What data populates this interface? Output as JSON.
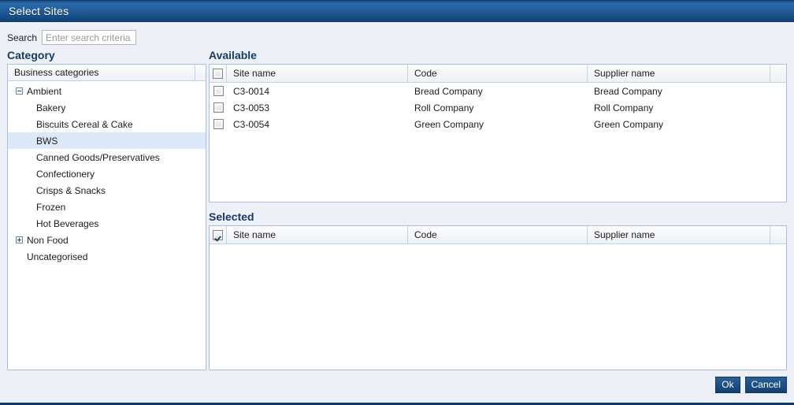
{
  "window": {
    "title": "Select Sites"
  },
  "search": {
    "label": "Search",
    "placeholder": "Enter search criteria",
    "value": ""
  },
  "category": {
    "heading": "Category",
    "tree_header": "Business categories",
    "nodes": [
      {
        "label": "Ambient",
        "level": 0,
        "toggle": "minus",
        "selected": false
      },
      {
        "label": "Bakery",
        "level": 1,
        "toggle": "none",
        "selected": false
      },
      {
        "label": "Biscuits Cereal & Cake",
        "level": 1,
        "toggle": "none",
        "selected": false
      },
      {
        "label": "BWS",
        "level": 1,
        "toggle": "none",
        "selected": true
      },
      {
        "label": "Canned Goods/Preservatives",
        "level": 1,
        "toggle": "none",
        "selected": false
      },
      {
        "label": "Confectionery",
        "level": 1,
        "toggle": "none",
        "selected": false
      },
      {
        "label": "Crisps & Snacks",
        "level": 1,
        "toggle": "none",
        "selected": false
      },
      {
        "label": "Frozen",
        "level": 1,
        "toggle": "none",
        "selected": false
      },
      {
        "label": "Hot Beverages",
        "level": 1,
        "toggle": "none",
        "selected": false
      },
      {
        "label": "Non Food",
        "level": 0,
        "toggle": "plus",
        "selected": false
      },
      {
        "label": "Uncategorised",
        "level": 0,
        "toggle": "none",
        "selected": false
      }
    ]
  },
  "available": {
    "heading": "Available",
    "header_checkbox_checked": false,
    "columns": [
      "Site name",
      "Code",
      "Supplier name"
    ],
    "rows": [
      {
        "checked": false,
        "site_name": "C3-0014",
        "code": "Bread Company",
        "supplier_name": "Bread Company"
      },
      {
        "checked": false,
        "site_name": "C3-0053",
        "code": "Roll Company",
        "supplier_name": "Roll Company"
      },
      {
        "checked": false,
        "site_name": "C3-0054",
        "code": "Green Company",
        "supplier_name": "Green Company"
      }
    ]
  },
  "selected": {
    "heading": "Selected",
    "header_checkbox_checked": true,
    "columns": [
      "Site name",
      "Code",
      "Supplier name"
    ],
    "rows": []
  },
  "footer": {
    "ok_label": "Ok",
    "cancel_label": "Cancel"
  },
  "colors": {
    "title_bar": "#1d5690",
    "accent": "#173c63",
    "page_bg": "#edf1f7",
    "selection": "#dce8f8",
    "button": "#1d5086"
  }
}
